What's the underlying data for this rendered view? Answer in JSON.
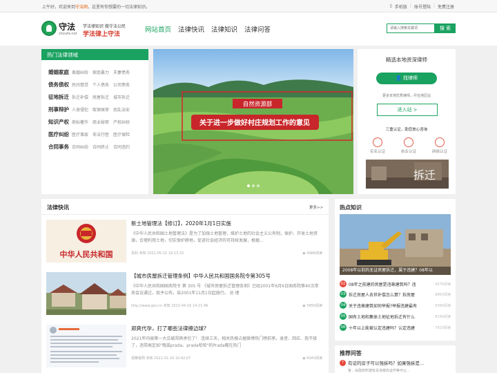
{
  "topbar": {
    "welcome_prefix": "上午好，欢迎来到",
    "site_name": "守法网",
    "welcome_suffix": "，这里有你想要的一切法律知识。",
    "mobile": "手机版",
    "login": "账号登陆",
    "register": "免费注册"
  },
  "logo": {
    "brand": "守法",
    "domain": "shoufa.net",
    "slogan1": "学法律知识  做守法公民",
    "slogan2": "学法律上守法"
  },
  "nav": [
    "网站首页",
    "法律快讯",
    "法律知识",
    "法律问答"
  ],
  "search": {
    "placeholder": "请输入搜索关键词",
    "button": "搜 索"
  },
  "categories": {
    "title": "热门法律领域",
    "rows": [
      {
        "main": "婚姻家庭",
        "subs": [
          "离婚纠纷",
          "家庭暴力",
          "夫妻债务"
        ]
      },
      {
        "main": "债务债权",
        "subs": [
          "民间借贷",
          "个人债务",
          "公司债务"
        ]
      },
      {
        "main": "征地拆迁",
        "subs": [
          "拆迁补偿",
          "房屋拆迁",
          "城市拆迁"
        ]
      },
      {
        "main": "刑事辩护",
        "subs": [
          "人身侵犯",
          "取保候审",
          "扰乱治安"
        ]
      },
      {
        "main": "知识产权",
        "subs": [
          "商标著作",
          "商业秘密",
          "产权纠纷"
        ]
      },
      {
        "main": "医疗纠纷",
        "subs": [
          "医疗事故",
          "非法行医",
          "医疗保险"
        ]
      },
      {
        "main": "合同事务",
        "subs": [
          "合同纠纷",
          "合同终止",
          "合同违约"
        ]
      }
    ]
  },
  "banner": {
    "badge": "自然资源部",
    "headline": "关于进一步做好村庄规划工作的意见"
  },
  "lawyer": {
    "title": "精选本地资深律师",
    "button": "找律师",
    "hint": "更多本地优秀律师，尽在地区站",
    "enter": "进入站 >",
    "three": "三重认证，助您放心咨询",
    "certs": [
      "实名认证",
      "执业认证",
      "网络认证"
    ],
    "ad_text": "拆迁"
  },
  "news": {
    "title": "法律快讯",
    "more": "更多>>",
    "articles": [
      {
        "title": "新土地管理法【修订】，2020年1月1日实施",
        "desc": "《中华人民共和国土地管理法》是为了加强土地管理，维护土地的社会主义公有制，保护、开发土地资源，合理利用土地，切实保护耕地，促进社会经济的可持续发展，根据...",
        "meta": "百科    未知    2021-05-15 19:13:32",
        "views": "4966阅读",
        "thumb_text": "中华人民共和国"
      },
      {
        "title": "【城市房屋拆迁管理条例】中华人民共和国国务院令第305号",
        "desc": "《中华人民共和国国务院令 第 305 号 《城市房屋拆迁管理条例》已经2001年6月6日国务院第40次常务会议通过，现予公布，自2001年11月1日起施行。 总 理",
        "meta": "http://www.gov.cn    未知    2021-04-16 14:21:46",
        "views": "5855阅读",
        "thumb_text": ""
      },
      {
        "title": "郑爽代孕，打了哪些法律擦边球?",
        "desc": "2021年内娱第一大瓜被郑爽承包了！ 连续三天，相关热搜占据微博热门榜前茅。录音、回应、我不接了，违带高定如\"哦滋prada、prada哈哈\"的Prada都在热门",
        "meta": "观察者网    未知    2021-01-20 10:42:07",
        "views": "6043阅读",
        "thumb_text": ""
      }
    ]
  },
  "hot": {
    "title": "热点知识",
    "caption": "2008年以前的无证房屋拆迁，属于违建？08年以",
    "items": [
      {
        "num": "02",
        "text": "08年之前建的房屋是违章建筑吗？违",
        "views": "9576阅读"
      },
      {
        "num": "03",
        "text": "拆迁房屋人去世补偿怎么算？拆房屋",
        "views": "8863阅读"
      },
      {
        "num": "04",
        "text": "关于违章建筑如何举报?举报违建最有",
        "views": "8380阅读"
      },
      {
        "num": "05",
        "text": "国有土地和集体土地征地拆迁有什么",
        "views": "8156阅读"
      },
      {
        "num": "06",
        "text": "十年以上能被认定违建吗？认定违建",
        "views": "7823阅读"
      }
    ]
  },
  "qa": {
    "title": "推荐问答",
    "question": "有证的房子可以强拆吗？如果强拆是...",
    "sub": "答：由政府所建有关违章的证件等可以..."
  }
}
